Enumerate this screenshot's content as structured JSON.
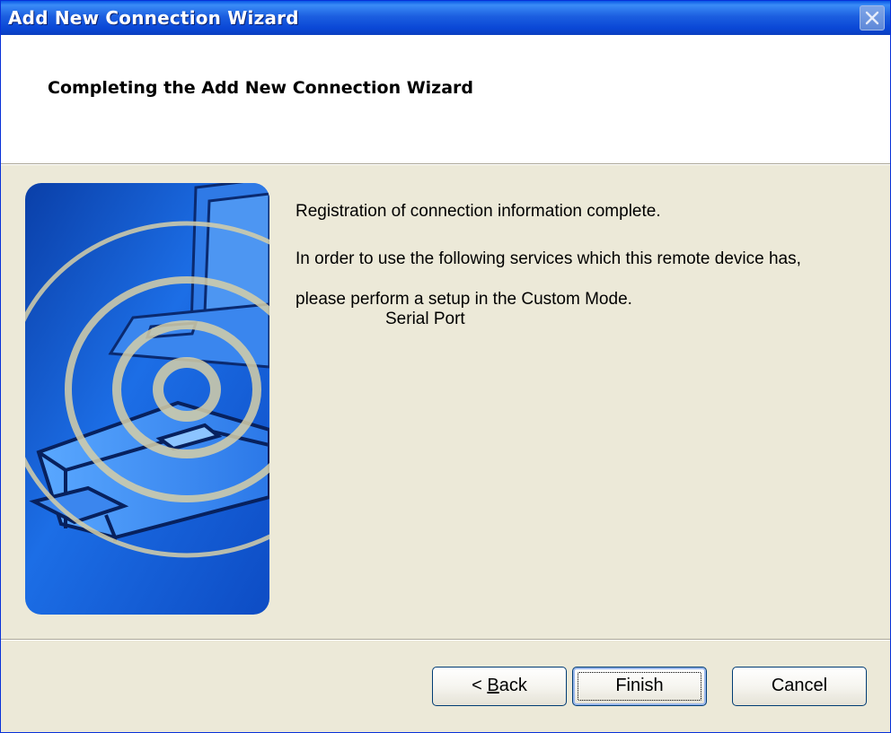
{
  "window": {
    "title": "Add New Connection Wizard"
  },
  "header": {
    "title": "Completing the Add New Connection Wizard"
  },
  "content": {
    "line1": "Registration of connection information complete.",
    "line2": "In order to use the following services which this remote device has,",
    "line3": "please perform a setup in the Custom Mode.",
    "service": "Serial Port"
  },
  "buttons": {
    "back_prefix": "< ",
    "back_accel": "B",
    "back_rest": "ack",
    "finish": "Finish",
    "cancel": "Cancel"
  },
  "icons": {
    "close": "close-icon",
    "illustration": "wireless-connection-illustration"
  },
  "colors": {
    "titlebar": "#0a47d6",
    "dialog_bg": "#ece9d8",
    "header_bg": "#ffffff",
    "art_blue": "#1a6be0"
  }
}
